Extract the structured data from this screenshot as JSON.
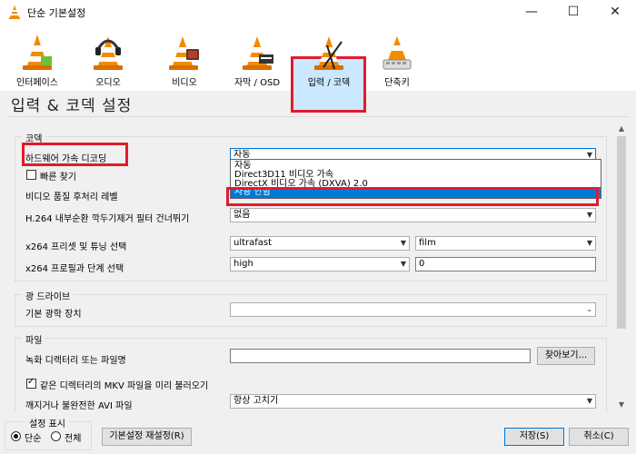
{
  "window": {
    "title": "단순 기본설정",
    "minimize": "—",
    "maximize": "☐",
    "close": "✕"
  },
  "toolbar": {
    "items": [
      {
        "label": "인터페이스",
        "icon": "vlc-cone-interface-icon"
      },
      {
        "label": "오디오",
        "icon": "vlc-cone-headphones-icon"
      },
      {
        "label": "비디오",
        "icon": "vlc-cone-video-icon"
      },
      {
        "label": "자막 / OSD",
        "icon": "vlc-cone-subtitles-icon"
      },
      {
        "label": "입력 / 코덱",
        "icon": "vlc-cone-codecs-icon"
      },
      {
        "label": "단축키",
        "icon": "vlc-cone-hotkeys-icon"
      }
    ],
    "active_index": 4
  },
  "section_title": "입력 & 코덱 설정",
  "codecs": {
    "group_label": "코덱",
    "hw_decoding_label": "하드웨어 가속 디코딩",
    "hw_decoding_value": "자동",
    "fast_seek_label": "빠른 찾기",
    "postproc_label": "비디오 품질 후처리 레벨",
    "h264_loop_label": "H.264 내부순환 깍두기제거 필터 건너뛰기",
    "h264_loop_value": "없음",
    "x264_preset_label": "x264 프리셋 및 튜닝 선택",
    "x264_preset_value": "ultrafast",
    "x264_tune_value": "film",
    "x264_profile_label": "x264 프로필과 단계 선택",
    "x264_profile_value": "high",
    "x264_level_value": "0"
  },
  "dropdown": {
    "options": [
      "자동",
      "Direct3D11 비디오 가속",
      "DirectX 비디오 가속 (DXVA) 2.0",
      "사용 안함"
    ],
    "highlighted_index": 3
  },
  "optical": {
    "group_label": "광 드라이브",
    "device_label": "기본 광학 장치",
    "device_value": ""
  },
  "files": {
    "group_label": "파일",
    "record_dir_label": "녹화 디렉터리 또는 파일명",
    "record_dir_value": "",
    "browse_label": "찾아보기...",
    "preload_mkv_label": "같은 디렉터리의 MKV 파일을 미리 불러오기",
    "broken_avi_label": "깨지거나 불완전한 AVI 파일",
    "broken_avi_value": "항상 고치기"
  },
  "bottom": {
    "show_settings_label": "설정 표시",
    "simple_label": "단순",
    "all_label": "전체",
    "reset_label": "기본설정 재설정(R)",
    "save_label": "저장(S)",
    "cancel_label": "취소(C)"
  },
  "colors": {
    "highlight_red": "#e21b2d",
    "selection_blue": "#0078d7",
    "active_tab_bg": "#cce8ff"
  }
}
